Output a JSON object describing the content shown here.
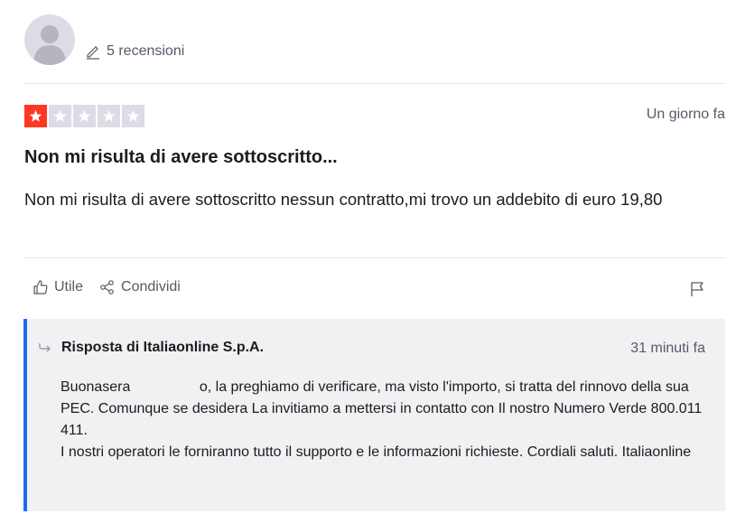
{
  "reviewer": {
    "reviews_count_label": "5 recensioni",
    "avatar_icon": "person-silhouette-icon"
  },
  "review": {
    "rating": 1,
    "rating_max": 5,
    "date": "Un giorno fa",
    "title": "Non mi risulta di avere sottoscritto...",
    "body": "Non mi risulta di avere sottoscritto nessun contratto,mi trovo un addebito di euro 19,80"
  },
  "actions": {
    "useful_label": "Utile",
    "share_label": "Condividi"
  },
  "reply": {
    "author_label": "Risposta di Italiaonline S.p.A.",
    "date": "31 minuti fa",
    "text_pre": "Buonasera ",
    "text_post": "o, la preghiamo di verificare, ma visto l'importo, si tratta del rinnovo della sua PEC. Comunque se desidera La invitiamo a mettersi in contatto con Il nostro Numero Verde 800.011 411.",
    "text_line2": "I nostri operatori le forniranno tutto il supporto e le informazioni richieste. Cordiali saluti. Italiaonline"
  },
  "colors": {
    "star_active": "#ff3722",
    "star_inactive": "#dcdce6",
    "reply_accent": "#1c6bf2",
    "reply_background": "#f1f1f4"
  }
}
